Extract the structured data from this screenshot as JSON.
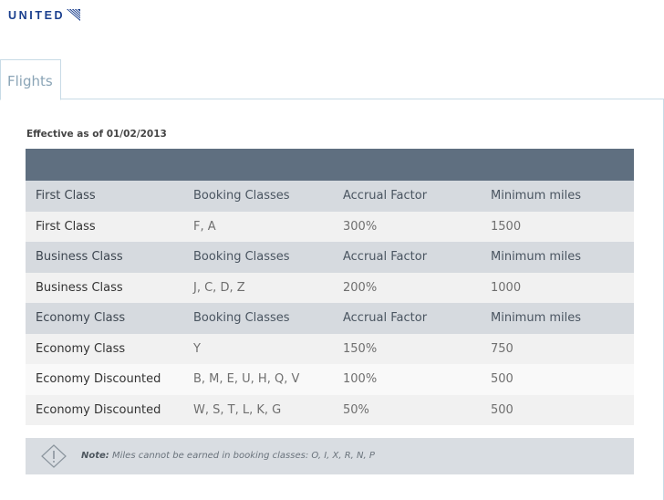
{
  "brand": {
    "name": "UNITED"
  },
  "tabs": [
    {
      "label": "Flights"
    }
  ],
  "effective_date": "Effective as of 01/02/2013",
  "table": {
    "rows": [
      {
        "kind": "header",
        "cells": [
          "First Class",
          "Booking Classes",
          "Accrual Factor",
          "Minimum miles"
        ]
      },
      {
        "kind": "odd",
        "cells": [
          "First Class",
          "F, A",
          "300%",
          "1500"
        ]
      },
      {
        "kind": "header",
        "cells": [
          "Business Class",
          "Booking Classes",
          "Accrual Factor",
          "Minimum miles"
        ]
      },
      {
        "kind": "odd",
        "cells": [
          "Business Class",
          "J, C, D, Z",
          "200%",
          "1000"
        ]
      },
      {
        "kind": "header",
        "cells": [
          "Economy Class",
          "Booking Classes",
          "Accrual Factor",
          "Minimum miles"
        ]
      },
      {
        "kind": "odd",
        "cells": [
          "Economy Class",
          "Y",
          "150%",
          "750"
        ]
      },
      {
        "kind": "even",
        "cells": [
          "Economy Discounted",
          "B, M, E, U, H, Q, V",
          "100%",
          "500"
        ]
      },
      {
        "kind": "odd",
        "cells": [
          "Economy Discounted",
          "W, S, T, L, K, G",
          "50%",
          "500"
        ]
      }
    ]
  },
  "note": {
    "label": "Note:",
    "text": "Miles cannot be earned in booking classes: O, I, X, R, N, P",
    "icon": "warning-diamond-icon"
  },
  "colors": {
    "brand_blue": "#1a3f8e",
    "table_head": "#5f6f80",
    "row_header": "#d6dadf",
    "note_bg": "#d9dde2"
  }
}
